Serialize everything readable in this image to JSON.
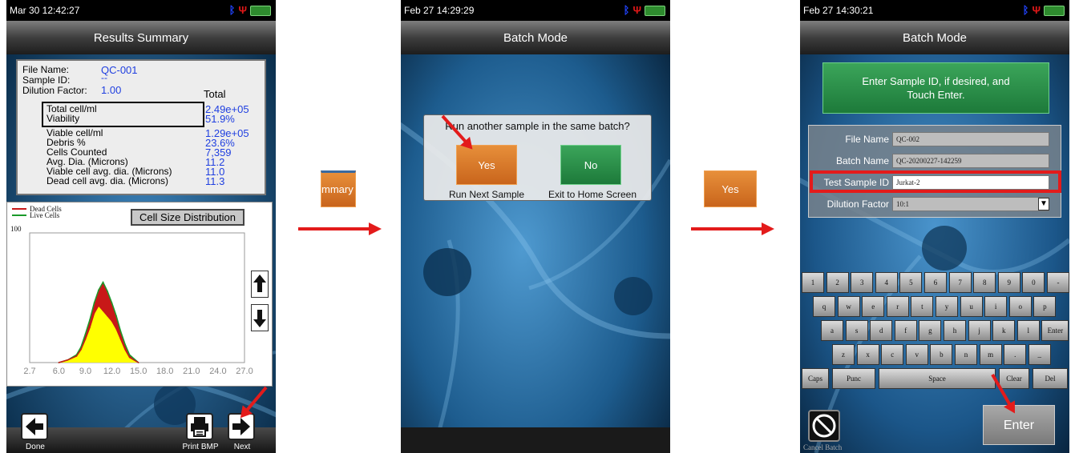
{
  "screen1": {
    "status_time": "Mar 30 12:42:27",
    "title": "Results Summary",
    "file_name_label": "File Name:",
    "file_name_value": "QC-001",
    "sample_id_label": "Sample ID:",
    "sample_id_value": "--",
    "dilution_label": "Dilution Factor:",
    "dilution_value": "1.00",
    "total_header": "Total",
    "rows_boxed": [
      {
        "label": "Total cell/ml",
        "value": "2.49e+05"
      },
      {
        "label": "Viability",
        "value": "51.9%"
      }
    ],
    "rows": [
      {
        "label": "Viable cell/ml",
        "value": "1.29e+05"
      },
      {
        "label": "Debris %",
        "value": "23.6%"
      },
      {
        "label": "Cells Counted",
        "value": "7,359"
      },
      {
        "label": "Avg. Dia. (Microns)",
        "value": "11.2"
      },
      {
        "label": "Viable cell avg. dia. (Microns)",
        "value": "11.0"
      },
      {
        "label": "Dead cell avg. dia. (Microns)",
        "value": "11.3"
      }
    ],
    "chart_title_button": "Cell Size Distribution",
    "legend_dead": "Dead Cells",
    "legend_live": "Live Cells",
    "chart_data": {
      "type": "area",
      "title": "",
      "xlabel": "",
      "ylabel": "",
      "x_ticks": [
        "2.7",
        "6.0",
        "9.0",
        "12.0",
        "15.0",
        "18.0",
        "21.0",
        "24.0",
        "27.0"
      ],
      "y_ticks": [
        "100"
      ],
      "xlim": [
        2.7,
        27.0
      ],
      "ylim": [
        0,
        100
      ],
      "series": [
        {
          "name": "Live Cells",
          "color": "#1a9a2a",
          "x": [
            6,
            7,
            8,
            8.5,
            9,
            9.5,
            10,
            10.5,
            11,
            11.5,
            12,
            12.5,
            13,
            13.5,
            14,
            15
          ],
          "y": [
            0,
            2,
            6,
            12,
            22,
            33,
            46,
            56,
            62,
            55,
            46,
            36,
            24,
            14,
            6,
            0
          ]
        },
        {
          "name": "Dead Cells",
          "color": "#c81818",
          "x": [
            6,
            7,
            8,
            8.5,
            9,
            9.5,
            10,
            10.5,
            11,
            11.5,
            12,
            12.5,
            13,
            13.5,
            14,
            15
          ],
          "y": [
            0,
            2,
            5,
            10,
            18,
            27,
            38,
            44,
            40,
            36,
            32,
            26,
            18,
            10,
            4,
            0
          ]
        }
      ]
    },
    "done_label": "Done",
    "print_label": "Print BMP",
    "next_label": "Next",
    "colors": {
      "accent_value": "#1f3fe0",
      "histogram_fill": "#ffff00"
    }
  },
  "connector1": {
    "button_label": "mmary"
  },
  "screen2": {
    "status_time": "Feb 27 14:29:29",
    "title": "Batch Mode",
    "dialog_question": "Run another sample in the same batch?",
    "yes_label": "Yes",
    "no_label": "No",
    "yes_caption": "Run Next Sample",
    "no_caption": "Exit to Home Screen"
  },
  "connector2": {
    "button_label": "Yes"
  },
  "screen3": {
    "status_time": "Feb 27 14:30:21",
    "title": "Batch Mode",
    "instruction": "Enter Sample ID, if desired, and Touch Enter.",
    "fields": [
      {
        "label": "File Name",
        "value": "QC-002"
      },
      {
        "label": "Batch Name",
        "value": "QC-20200227-142259"
      },
      {
        "label": "Test Sample ID",
        "value": "Jurkat-2"
      },
      {
        "label": "Dilution Factor",
        "value": "10:1"
      }
    ],
    "keyboard_rows": [
      [
        "1",
        "2",
        "3",
        "4",
        "5",
        "6",
        "7",
        "8",
        "9",
        "0",
        "-"
      ],
      [
        "q",
        "w",
        "e",
        "r",
        "t",
        "y",
        "u",
        "i",
        "o",
        "p"
      ],
      [
        "a",
        "s",
        "d",
        "f",
        "g",
        "h",
        "j",
        "k",
        "l",
        "Enter"
      ],
      [
        "z",
        "x",
        "c",
        "v",
        "b",
        "n",
        "m",
        ".",
        "_"
      ],
      [
        "Caps",
        "Punc",
        "Space",
        "Clear",
        "Del"
      ]
    ],
    "enter_label": "Enter",
    "cancel_label": "Cancel Batch"
  }
}
